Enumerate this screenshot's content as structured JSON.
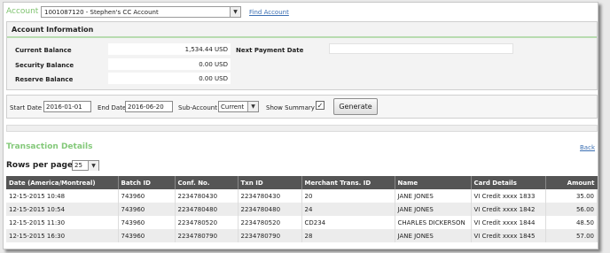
{
  "account": {
    "label": "Account",
    "selected": "1001087120 - Stephen's CC Account",
    "find_link": "Find Account"
  },
  "account_info": {
    "title": "Account Information",
    "current_balance_label": "Current Balance",
    "current_balance_value": "1,534.44 USD",
    "security_balance_label": "Security Balance",
    "security_balance_value": "0.00 USD",
    "reserve_balance_label": "Reserve Balance",
    "reserve_balance_value": "0.00 USD",
    "next_payment_date_label": "Next Payment Date",
    "next_payment_date_value": ""
  },
  "filters": {
    "start_date_label": "Start Date",
    "start_date_value": "2016-01-01",
    "end_date_label": "End Date",
    "end_date_value": "2016-06-20",
    "sub_account_label": "Sub-Account",
    "sub_account_value": "Current",
    "show_summary_label": "Show Summary",
    "show_summary_checked": true,
    "generate_label": "Generate"
  },
  "transactions": {
    "title": "Transaction Details",
    "back_link": "Back",
    "rows_per_page_label": "Rows per page",
    "rows_per_page_value": "25",
    "columns": [
      "Date (America/Montreal)",
      "Batch ID",
      "Conf. No.",
      "Txn ID",
      "Merchant Trans. ID",
      "Name",
      "Card Details",
      "Amount"
    ],
    "rows": [
      [
        "12-15-2015 10:48",
        "743960",
        "2234780430",
        "2234780430",
        "20",
        "JANE JONES",
        "VI Credit xxxx 1833",
        "35.00"
      ],
      [
        "12-15-2015 10:54",
        "743960",
        "2234780480",
        "2234780480",
        "24",
        "JANE JONES",
        "VI Credit xxxx 1842",
        "56.00"
      ],
      [
        "12-15-2015 11:30",
        "743960",
        "2234780520",
        "2234780520",
        "CD234",
        "CHARLES DICKERSON",
        "VI Credit xxxx 1844",
        "48.50"
      ],
      [
        "12-15-2015 16:30",
        "743960",
        "2234780790",
        "2234780790",
        "28",
        "JANE JONES",
        "VI Credit xxxx 1845",
        "57.00"
      ]
    ]
  },
  "colors": {
    "accent_green": "#7fc36f",
    "link_blue": "#3b6fb3",
    "table_header": "#555555"
  }
}
